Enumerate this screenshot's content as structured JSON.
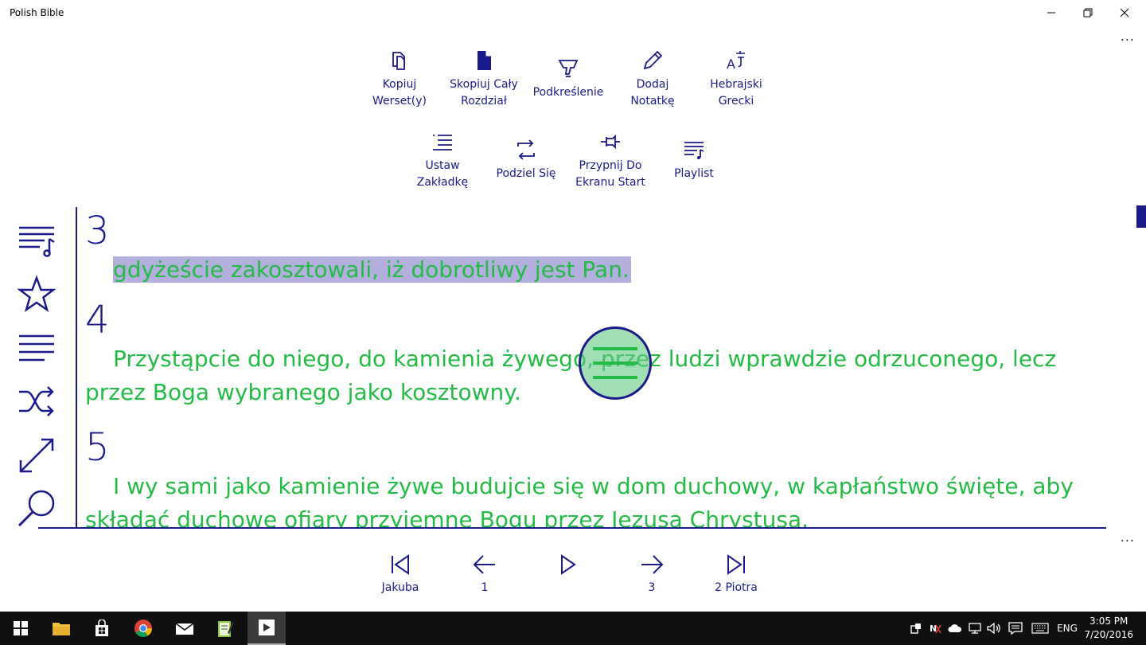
{
  "window": {
    "title": "Polish Bible",
    "more": "..."
  },
  "commands": [
    {
      "label": "Kopiuj\nWerset(y)",
      "icon": "copy-icon"
    },
    {
      "label": "Skopiuj Cały\nRozdział",
      "icon": "document-icon"
    },
    {
      "label": "Podkreślenie",
      "icon": "highlighter-icon"
    },
    {
      "label": "Dodaj\nNotatkę",
      "icon": "pencil-icon"
    },
    {
      "label": "Hebrajski\nGrecki",
      "icon": "translate-icon"
    },
    {
      "label": "Ustaw\nZakładkę",
      "icon": "list-icon"
    },
    {
      "label": "Podziel Się",
      "icon": "share-icon"
    },
    {
      "label": "Przypnij Do\nEkranu Start",
      "icon": "pin-icon"
    },
    {
      "label": "Playlist",
      "icon": "playlist-icon"
    }
  ],
  "sidebar": [
    "playlist-icon",
    "star-icon",
    "list-icon",
    "shuffle-icon",
    "resize-icon",
    "search-icon"
  ],
  "verses": [
    {
      "number": "3",
      "text": "gdyżeście zakosztowali, iż dobrotliwy jest Pan.",
      "highlighted": true
    },
    {
      "number": "4",
      "text": "Przystąpcie do niego, do kamienia żywego, przez ludzi wprawdzie odrzuconego, lecz przez Boga wybranego jako kosztowny.",
      "highlighted": false
    },
    {
      "number": "5",
      "text": "I wy sami jako kamienie żywe budujcie się w dom duchowy, w kapłaństwo święte, aby składać duchowe ofiary przyjemne Bogu przez Jezusa Chrystusa.",
      "highlighted": false
    }
  ],
  "nav": {
    "first": "Jakuba",
    "prev": "1",
    "play": "",
    "next": "3",
    "last": "2 Piotra"
  },
  "taskbar": {
    "language": "ENG",
    "time": "3:05 PM",
    "date": "7/20/2016"
  },
  "colors": {
    "accent": "#1a1a8a",
    "verse_text": "#22bb44",
    "highlight": "#b3b0e0"
  }
}
